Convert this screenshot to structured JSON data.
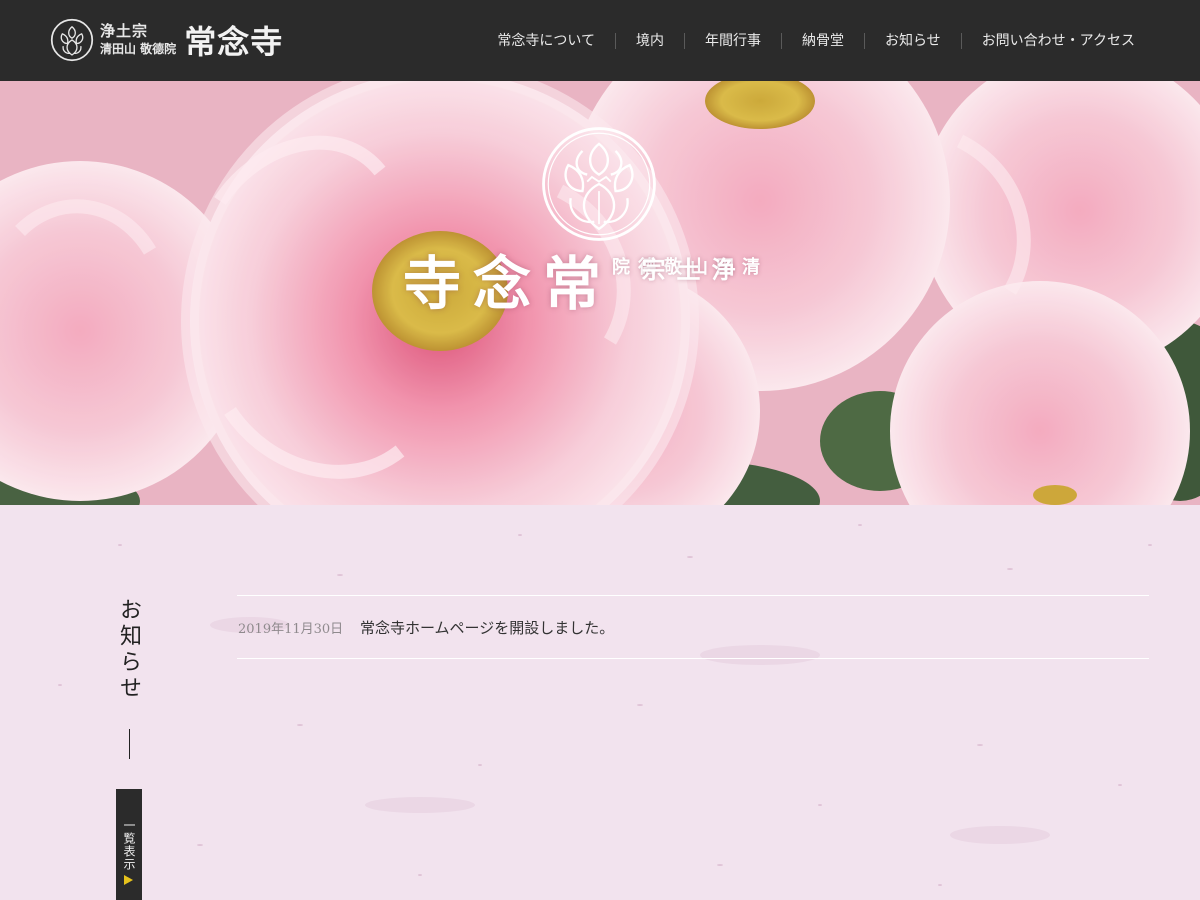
{
  "header": {
    "brand": {
      "school": "浄土宗",
      "mountain": "清田山 敬德院",
      "name": "常念寺",
      "crest_icon": "peony-crest-icon"
    },
    "nav": [
      {
        "label": "常念寺について"
      },
      {
        "label": "境内"
      },
      {
        "label": "年間行事"
      },
      {
        "label": "納骨堂"
      },
      {
        "label": "お知らせ"
      },
      {
        "label": "お問い合わせ・アクセス"
      }
    ],
    "colors": {
      "background": "#2b2b2b",
      "text": "#e9e9e9"
    }
  },
  "hero": {
    "image": "pink-peony-flowers",
    "school": "浄土宗",
    "mountain": "清田山 敬德院",
    "name": "常念寺"
  },
  "news": {
    "section_title": "お知らせ",
    "list_button_label": "一覧表示",
    "items": [
      {
        "date": "2019年11月30日",
        "title": "常念寺ホームページを開設しました。"
      }
    ],
    "colors": {
      "background": "#f3e5ef",
      "button": "#2b2b2b",
      "arrow": "#e6c21c"
    }
  }
}
